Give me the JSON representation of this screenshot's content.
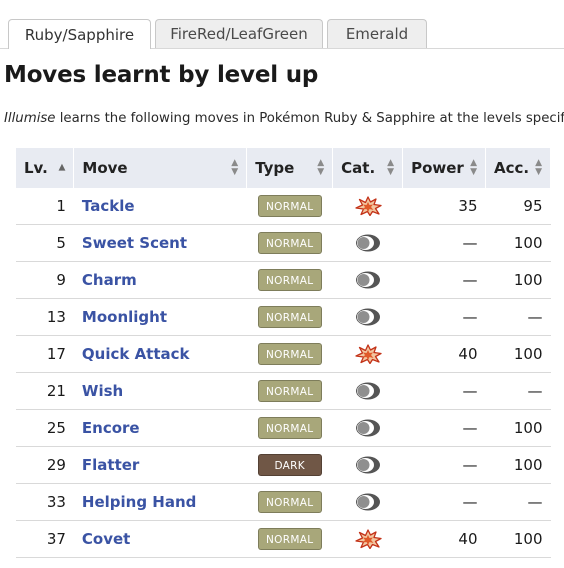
{
  "tabs": [
    {
      "label": "Ruby/Sapphire",
      "active": true
    },
    {
      "label": "FireRed/LeafGreen",
      "active": false
    },
    {
      "label": "Emerald",
      "active": false
    }
  ],
  "title": "Moves learnt by level up",
  "intro": {
    "pokemon": "Illumise",
    "text": " learns the following moves in Pokémon Ruby & Sapphire at the levels specified."
  },
  "columns": [
    "Lv.",
    "Move",
    "Type",
    "Cat.",
    "Power",
    "Acc."
  ],
  "type_colors": {
    "NORMAL": "#a8a77a",
    "DARK": "#705746"
  },
  "rows": [
    {
      "level": "1",
      "move": "Tackle",
      "type": "NORMAL",
      "category": "physical-icon",
      "power": "35",
      "accuracy": "95"
    },
    {
      "level": "5",
      "move": "Sweet Scent",
      "type": "NORMAL",
      "category": "status-icon",
      "power": "—",
      "accuracy": "100"
    },
    {
      "level": "9",
      "move": "Charm",
      "type": "NORMAL",
      "category": "status-icon",
      "power": "—",
      "accuracy": "100"
    },
    {
      "level": "13",
      "move": "Moonlight",
      "type": "NORMAL",
      "category": "status-icon",
      "power": "—",
      "accuracy": "—"
    },
    {
      "level": "17",
      "move": "Quick Attack",
      "type": "NORMAL",
      "category": "physical-icon",
      "power": "40",
      "accuracy": "100"
    },
    {
      "level": "21",
      "move": "Wish",
      "type": "NORMAL",
      "category": "status-icon",
      "power": "—",
      "accuracy": "—"
    },
    {
      "level": "25",
      "move": "Encore",
      "type": "NORMAL",
      "category": "status-icon",
      "power": "—",
      "accuracy": "100"
    },
    {
      "level": "29",
      "move": "Flatter",
      "type": "DARK",
      "category": "status-icon",
      "power": "—",
      "accuracy": "100"
    },
    {
      "level": "33",
      "move": "Helping Hand",
      "type": "NORMAL",
      "category": "status-icon",
      "power": "—",
      "accuracy": "—"
    },
    {
      "level": "37",
      "move": "Covet",
      "type": "NORMAL",
      "category": "physical-icon",
      "power": "40",
      "accuracy": "100"
    }
  ]
}
